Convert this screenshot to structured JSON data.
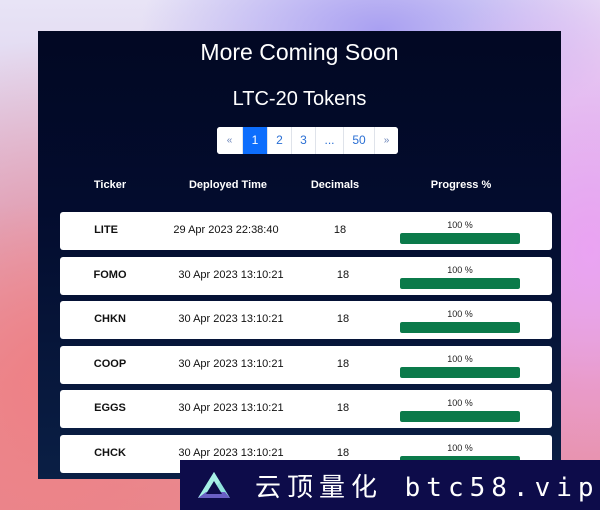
{
  "header": {
    "title": "More Coming Soon",
    "subtitle": "LTC-20 Tokens"
  },
  "pagination": {
    "prev_label": "«",
    "pages": [
      "1",
      "2",
      "3",
      "...",
      "50"
    ],
    "active_page": "1",
    "next_label": "»"
  },
  "table": {
    "columns": [
      "Ticker",
      "Deployed Time",
      "Decimals",
      "Progress %"
    ],
    "rows": [
      {
        "ticker": "LITE",
        "deployed": "29 Apr 2023 22:38:40",
        "decimals": "18",
        "progress_label": "100 %",
        "progress": 100
      },
      {
        "ticker": "FOMO",
        "deployed": "30 Apr 2023 13:10:21",
        "decimals": "18",
        "progress_label": "100 %",
        "progress": 100
      },
      {
        "ticker": "CHKN",
        "deployed": "30 Apr 2023 13:10:21",
        "decimals": "18",
        "progress_label": "100 %",
        "progress": 100
      },
      {
        "ticker": "COOP",
        "deployed": "30 Apr 2023 13:10:21",
        "decimals": "18",
        "progress_label": "100 %",
        "progress": 100
      },
      {
        "ticker": "EGGS",
        "deployed": "30 Apr 2023 13:10:21",
        "decimals": "18",
        "progress_label": "100 %",
        "progress": 100
      },
      {
        "ticker": "CHCK",
        "deployed": "30 Apr 2023 13:10:21",
        "decimals": "18",
        "progress_label": "100 %",
        "progress": 100
      }
    ]
  },
  "colors": {
    "panel_bg": "#020823",
    "active_page": "#0d6efd",
    "progress_fill": "#0b7a4a",
    "banner_bg": "#0d0c4a"
  },
  "watermark": {
    "icon": "triangle-logo-icon",
    "text": "云顶量化 btc58.vip"
  }
}
